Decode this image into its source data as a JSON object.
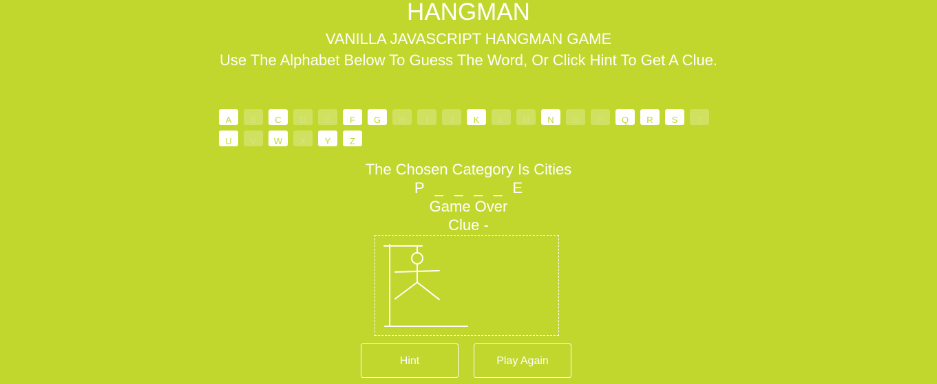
{
  "header": {
    "title": "HANGMAN",
    "subtitle": "VANILLA JAVASCRIPT HANGMAN GAME",
    "instructions": "Use The Alphabet Below To Guess The Word, Or Click Hint To Get A Clue."
  },
  "alphabet": [
    {
      "letter": "A",
      "used": false
    },
    {
      "letter": "B",
      "used": true
    },
    {
      "letter": "C",
      "used": false
    },
    {
      "letter": "D",
      "used": true
    },
    {
      "letter": "E",
      "used": true
    },
    {
      "letter": "F",
      "used": false
    },
    {
      "letter": "G",
      "used": false
    },
    {
      "letter": "H",
      "used": true
    },
    {
      "letter": "I",
      "used": true
    },
    {
      "letter": "J",
      "used": true
    },
    {
      "letter": "K",
      "used": false
    },
    {
      "letter": "L",
      "used": true
    },
    {
      "letter": "M",
      "used": true
    },
    {
      "letter": "N",
      "used": false
    },
    {
      "letter": "O",
      "used": true
    },
    {
      "letter": "P",
      "used": true
    },
    {
      "letter": "Q",
      "used": false
    },
    {
      "letter": "R",
      "used": false
    },
    {
      "letter": "S",
      "used": false
    },
    {
      "letter": "T",
      "used": true
    },
    {
      "letter": "U",
      "used": false
    },
    {
      "letter": "V",
      "used": true
    },
    {
      "letter": "W",
      "used": false
    },
    {
      "letter": "X",
      "used": true
    },
    {
      "letter": "Y",
      "used": false
    },
    {
      "letter": "Z",
      "used": false
    }
  ],
  "game": {
    "category": "The Chosen Category Is Cities",
    "word_slots": [
      "P",
      "_",
      "_",
      "_",
      "_",
      "E"
    ],
    "status": "Game Over",
    "clue": "Clue -"
  },
  "buttons": {
    "hint_label": "Hint",
    "reset_label": "Play Again"
  },
  "colors": {
    "background": "#c1d72e",
    "foreground": "#ffffff"
  }
}
